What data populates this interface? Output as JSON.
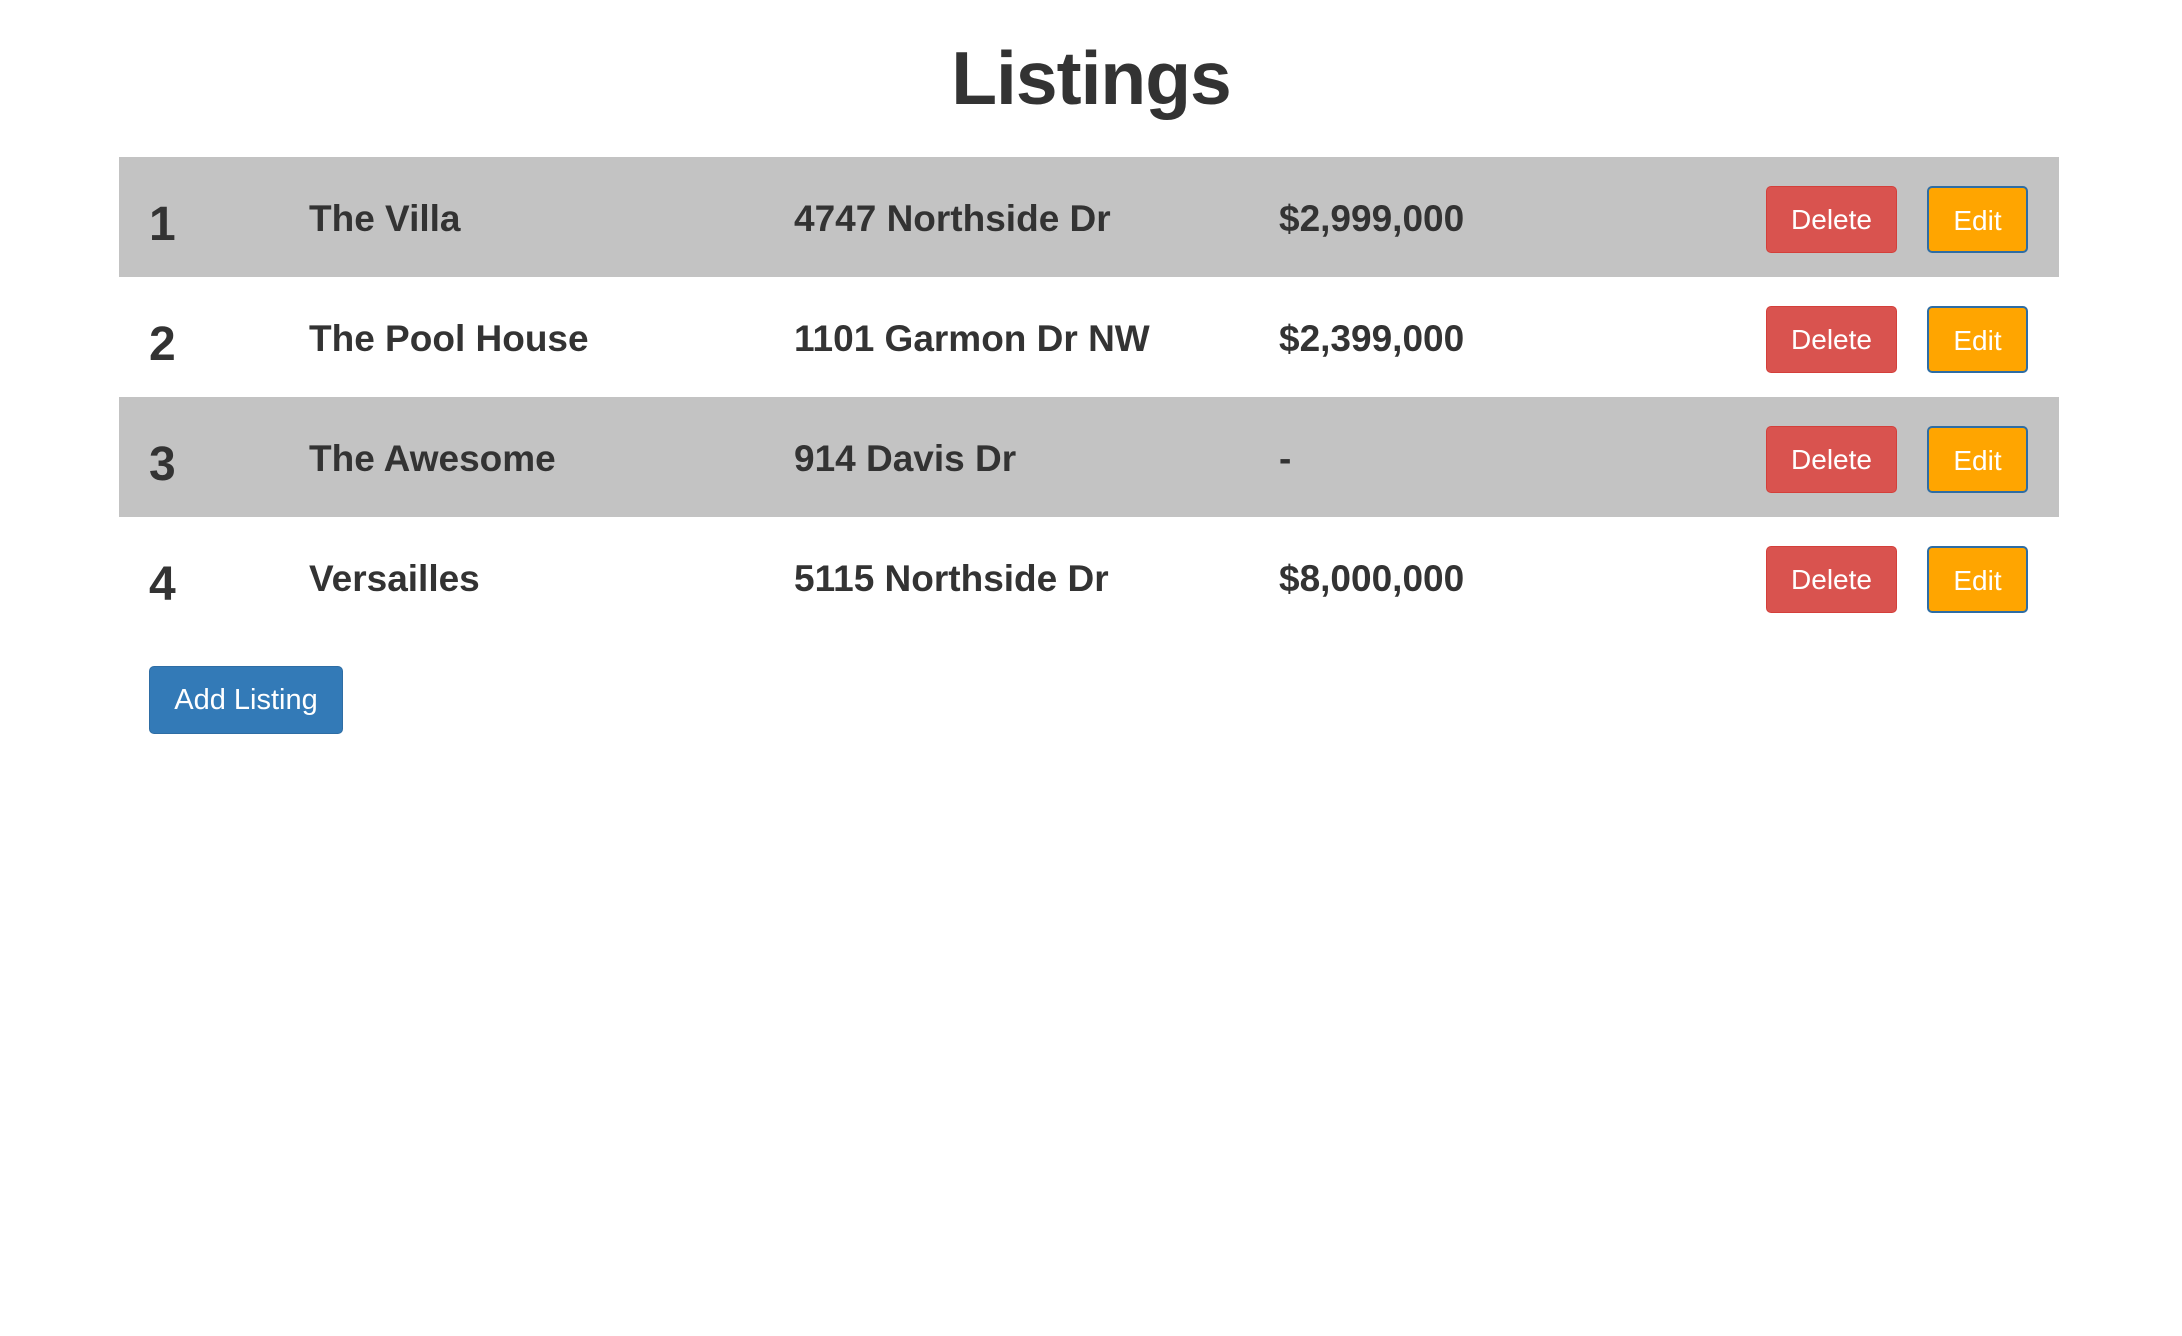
{
  "page": {
    "title": "Listings"
  },
  "colors": {
    "striped_row": "#c3c3c3",
    "delete_button": "#d9534f",
    "edit_button": "#ffa500",
    "add_button": "#337ab7",
    "text": "#333333"
  },
  "listings": [
    {
      "number": "1",
      "name": "The Villa",
      "address": "4747 Northside Dr",
      "price": "$2,999,000"
    },
    {
      "number": "2",
      "name": "The Pool House",
      "address": "1101 Garmon Dr NW",
      "price": "$2,399,000"
    },
    {
      "number": "3",
      "name": "The Awesome",
      "address": "914 Davis Dr",
      "price": "-"
    },
    {
      "number": "4",
      "name": "Versailles",
      "address": "5115 Northside Dr",
      "price": "$8,000,000"
    }
  ],
  "actions": {
    "delete_label": "Delete",
    "edit_label": "Edit",
    "add_label": "Add Listing"
  }
}
